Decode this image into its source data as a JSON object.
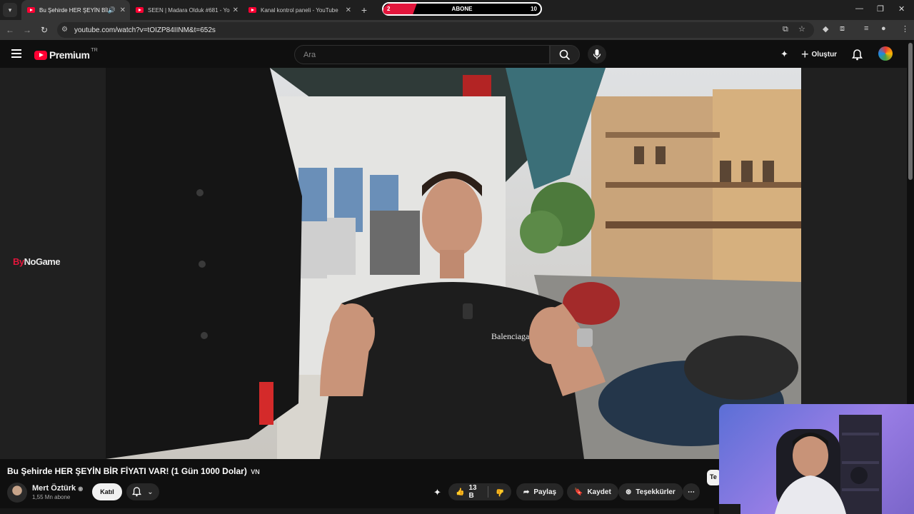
{
  "browser": {
    "tabs": [
      {
        "title": "Bu Şehirde HER ŞEYİN BİR F",
        "active": true
      },
      {
        "title": "SEEN | Madara Olduk #681 - Yo",
        "active": false
      },
      {
        "title": "Kanal kontrol paneli - YouTube",
        "active": false
      }
    ],
    "url": "youtube.com/watch?v=tOIZP84IINM&t=652s"
  },
  "overlay": {
    "abone_label": "ABONE",
    "current": "2",
    "goal": "10",
    "progress": 0.2,
    "sponsor_prefix": "By",
    "sponsor_name": "NoGame",
    "chat_peek": "Te"
  },
  "youtube": {
    "logo_text": "Premium",
    "logo_region": "TR",
    "search_placeholder": "Ara",
    "create_label": "Oluştur"
  },
  "video": {
    "title": "Bu Şehirde HER ŞEYİN BİR FİYATI VAR! (1 Gün 1000 Dolar)",
    "title_flag": "VN",
    "channel_name": "Mert Öztürk",
    "subscribers": "1,55 Mn abone",
    "join_label": "Katıl",
    "likes": "13 B",
    "share_label": "Paylaş",
    "save_label": "Kaydet",
    "thanks_label": "Teşekkürler"
  },
  "colors": {
    "brand_red": "#ff0033",
    "overlay_red": "#e3163c",
    "background": "#0f0f0f"
  }
}
